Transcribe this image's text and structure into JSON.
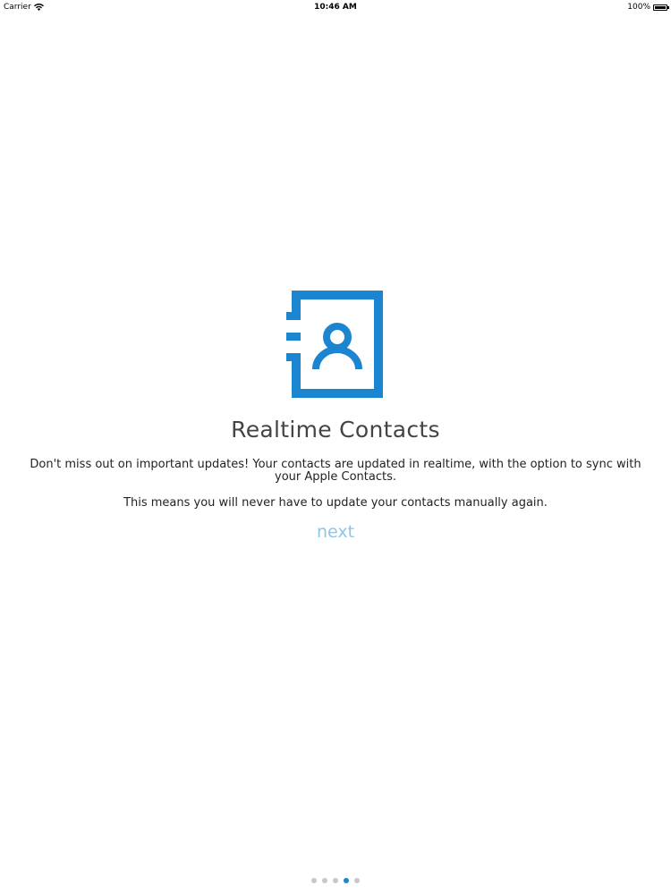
{
  "status_bar": {
    "carrier": "Carrier",
    "time": "10:46 AM",
    "battery_text": "100%",
    "battery_level": 1.0
  },
  "onboarding": {
    "icon": "contacts-book-icon",
    "accent_color": "#1b86cf",
    "title": "Realtime Contacts",
    "description": "Don't miss out on important updates! Your contacts are updated in realtime, with the option to sync with your Apple Contacts.",
    "description_2": "This means you will never have to update your contacts manually again.",
    "next_label": "next"
  },
  "pager": {
    "count": 5,
    "current_page": 4
  }
}
